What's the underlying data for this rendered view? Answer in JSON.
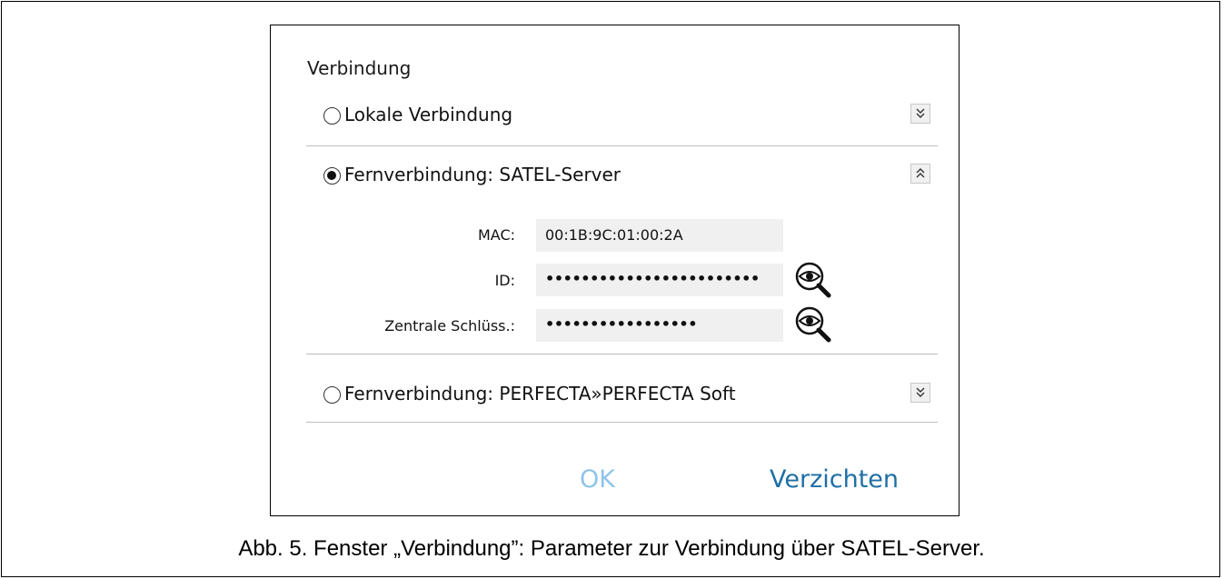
{
  "dialog": {
    "title": "Verbindung",
    "options": [
      {
        "label": "Lokale Verbindung",
        "selected": false,
        "expanded": false
      },
      {
        "label": "Fernverbindung: SATEL-Server",
        "selected": true,
        "expanded": true
      },
      {
        "label": "Fernverbindung: PERFECTA»PERFECTA Soft",
        "selected": false,
        "expanded": false
      }
    ],
    "fields": {
      "mac_label": "MAC:",
      "mac_value": "00:1B:9C:01:00:2A",
      "id_label": "ID:",
      "id_value": "••••••••••••••••••••••••",
      "key_label": "Zentrale Schlüss.:",
      "key_value": "•••••••••••••••••"
    },
    "buttons": {
      "ok": "OK",
      "cancel": "Verzichten"
    }
  },
  "caption": "Abb. 5. Fenster „Verbindung”: Parameter zur Verbindung über SATEL-Server.",
  "colors": {
    "ok_disabled": "#8fc3e8",
    "cancel": "#1f6fa5",
    "field_bg": "#f0f0f0",
    "divider": "#bdbdbd"
  },
  "icons": {
    "expand": "double-chevron-down-icon",
    "collapse": "double-chevron-up-icon",
    "show_password": "eye-magnifier-icon"
  }
}
